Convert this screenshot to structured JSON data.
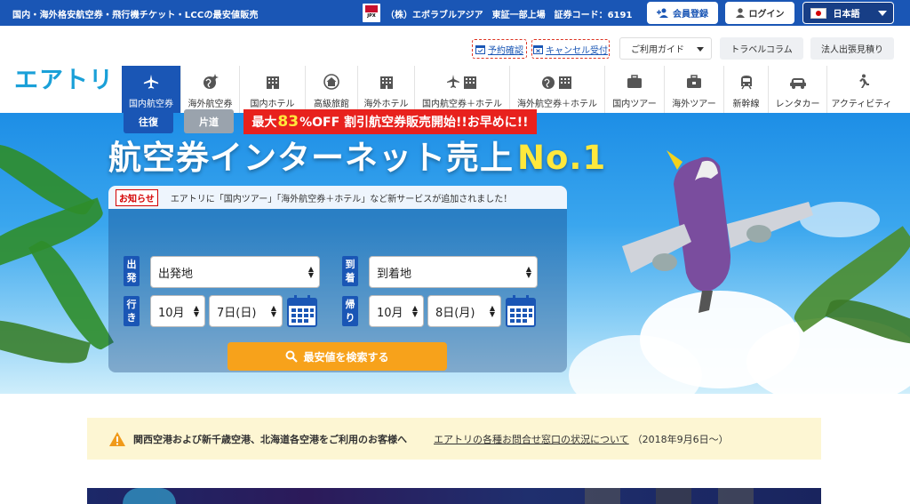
{
  "topbar": {
    "tagline": "国内・海外格安航空券・飛行機チケット・LCCの最安値販売",
    "company": "（株）エボラブルアジア　東証一部上場　証券コード：6191",
    "jpx_mark": "JPX",
    "register_label": "会員登録",
    "login_label": "ログイン",
    "language_label": "日本語"
  },
  "subnav": {
    "reservation_check": "予約確認",
    "cancel_accept": "キャンセル受付",
    "guide": "ご利用ガイド",
    "travel_column": "トラベルコラム",
    "corporate": "法人出張見積り"
  },
  "logo": "エアトリ",
  "nav": {
    "items": [
      {
        "label": "国内航空券",
        "icon": "plane-icon"
      },
      {
        "label": "海外航空券",
        "icon": "globe-plane-icon"
      },
      {
        "label": "国内ホテル",
        "icon": "hotel-icon"
      },
      {
        "label": "高級旅館",
        "icon": "ryokan-icon"
      },
      {
        "label": "海外ホテル",
        "icon": "hotel-icon"
      },
      {
        "label": "国内航空券＋ホテル",
        "icon": "plane-hotel-icon"
      },
      {
        "label": "海外航空券＋ホテル",
        "icon": "globe-hotel-icon"
      },
      {
        "label": "国内ツアー",
        "icon": "suitcase-icon"
      },
      {
        "label": "海外ツアー",
        "icon": "suitcase-icon"
      },
      {
        "label": "新幹線",
        "icon": "train-icon"
      },
      {
        "label": "レンタカー",
        "icon": "car-icon"
      },
      {
        "label": "アクティビティ",
        "icon": "runner-icon"
      }
    ]
  },
  "hero": {
    "title": "航空券インターネット売上",
    "title_highlight": "No.1",
    "notice_label": "お知らせ",
    "notice_text": "エアトリに「国内ツアー」「海外航空券＋ホテル」など新サービスが追加されました！",
    "trip_round": "往復",
    "trip_oneway": "片道",
    "sale_pre": "最大",
    "sale_big": "83",
    "sale_post": "%OFF 割引航空券販売開始!!お早めに!!",
    "depart_label_a": "出",
    "depart_label_b": "発",
    "arrive_label_a": "到",
    "arrive_label_b": "着",
    "go_label_a": "行",
    "go_label_b": "き",
    "back_label_a": "帰",
    "back_label_b": "り",
    "depart_placeholder": "出発地",
    "arrive_placeholder": "到着地",
    "go_month": "10月",
    "go_day": "7日(日)",
    "back_month": "10月",
    "back_day": "8日(月)",
    "search_label": "最安値を検索する"
  },
  "alert": {
    "title": "関西空港および新千歳空港、北海道各空港をご利用のお客様へ",
    "link": "エアトリの各種お問合せ窓口の状況について",
    "date": "（2018年9月6日〜）"
  },
  "colors": {
    "brand_blue": "#1a56b5",
    "logo_cyan": "#1aa0d8",
    "sale_red": "#e8211d",
    "search_orange": "#f7a21b",
    "highlight_yellow": "#ffe83c"
  }
}
